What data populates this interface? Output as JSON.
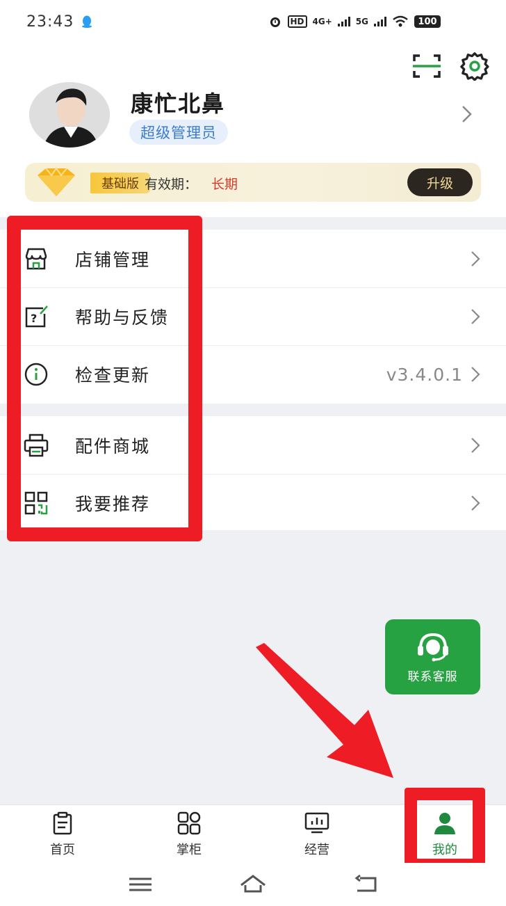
{
  "status_bar": {
    "time": "23:43",
    "network_1": "4G+",
    "network_2": "5G",
    "hd_label": "HD",
    "battery": "100"
  },
  "header": {
    "username": "康忙北鼻",
    "role": "超级管理员",
    "plan": {
      "name": "基础版",
      "validity_label": "有效期：",
      "validity_value": "长期",
      "upgrade_label": "升级"
    }
  },
  "menu": {
    "group1": [
      {
        "label": "店铺管理",
        "icon": "store-icon"
      },
      {
        "label": "帮助与反馈",
        "icon": "help-feedback-icon"
      },
      {
        "label": "检查更新",
        "icon": "info-icon",
        "value": "v3.4.0.1"
      }
    ],
    "group2": [
      {
        "label": "配件商城",
        "icon": "printer-icon"
      },
      {
        "label": "我要推荐",
        "icon": "qr-code-icon"
      }
    ]
  },
  "customer_service": {
    "label": "联系客服"
  },
  "tabs": [
    {
      "label": "首页",
      "icon": "clipboard-icon"
    },
    {
      "label": "掌柜",
      "icon": "grid-icon"
    },
    {
      "label": "经营",
      "icon": "chart-monitor-icon"
    },
    {
      "label": "我的",
      "icon": "person-icon",
      "active": true
    }
  ],
  "colors": {
    "accent_green": "#27a243",
    "annotation_red": "#ee1c25",
    "badge_blue": "#3a7bd5",
    "validity_red": "#d73b2a"
  }
}
